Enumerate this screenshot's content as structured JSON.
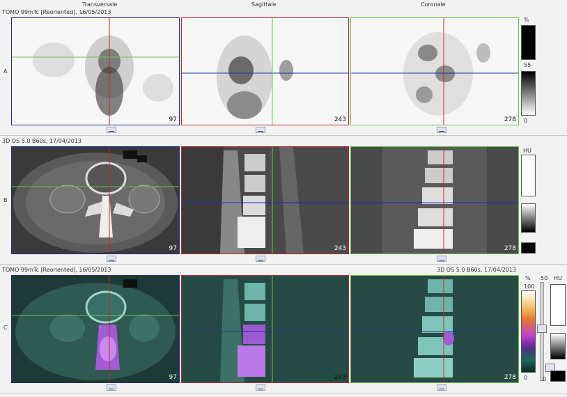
{
  "rows": [
    {
      "letter": "A",
      "series": "TOMO 99mTc [Reoriented], 16/05/2013"
    },
    {
      "letter": "B",
      "series": "3D OS 5.0 B60s, 17/04/2013"
    },
    {
      "letter": "C",
      "series": "TOMO 99mTc [Reoriented], 16/05/2013",
      "series_right": "3D OS 5.0 B60s, 17/04/2013"
    }
  ],
  "columns": [
    "Transversale",
    "Sagittale",
    "Coronale"
  ],
  "slices": {
    "transverse": "97",
    "sagittal": "243",
    "coronal": "278"
  },
  "scales": {
    "nm": {
      "unit": "%",
      "max": "55",
      "min": "0"
    },
    "ct": {
      "unit": "HU"
    },
    "fusion": {
      "unit": "%",
      "max": "100",
      "min": "0",
      "mix": "50",
      "unit2": "HU",
      "min2": "0"
    }
  },
  "colors": {
    "border_red": "#c0282a",
    "border_green": "#6cc24a",
    "border_blue": "#23297e",
    "cross_blue": "#1f2fb0"
  }
}
